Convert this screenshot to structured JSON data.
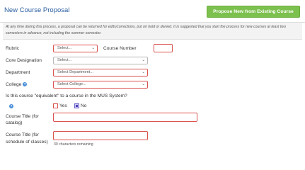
{
  "header": {
    "title": "New Course Proposal",
    "propose_button": "Propose New from Existing Course"
  },
  "notice": "At any time during this process, a proposal can be returned for edits/corrections, put on hold or denied. It is suggested that you start the process for new courses at least two semesters in advance, not including the summer semester.",
  "form": {
    "rubric_label": "Rubric",
    "rubric_value": "Select...",
    "course_number_label": "Course Number",
    "core_label": "Core Designation",
    "core_value": "Select...",
    "department_label": "Department",
    "department_value": "Select Department...",
    "college_label": "College",
    "college_value": "Select College...",
    "equivalent_question": "Is this course \"equivalent\" to a course in the MUS System?",
    "yes_label": "Yes",
    "no_label": "No",
    "title_catalog_label_1": "Course Title (for",
    "title_catalog_label_2": "catalog)",
    "title_schedule_label_1": "Course Title (for",
    "title_schedule_label_2": "schedule of classes)",
    "chars_remaining": "30 characters remaining"
  },
  "icons": {
    "dropdown": "chevron-down-icon",
    "help": "help-icon"
  },
  "colors": {
    "accent_green": "#7cc04d",
    "title_blue": "#2a5d9f",
    "required_red": "#d9534f"
  }
}
